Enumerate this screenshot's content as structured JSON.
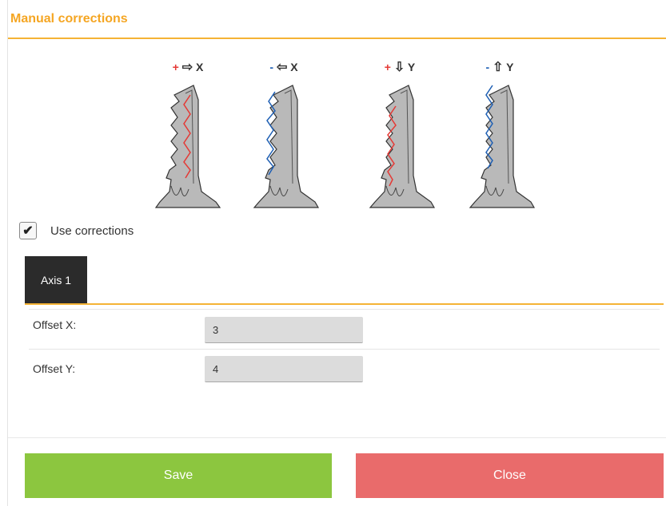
{
  "dialog": {
    "title": "Manual corrections"
  },
  "illustrations": [
    {
      "sign": "+",
      "arrow": "⇨",
      "axis": "X",
      "sign_color": "#e53935",
      "icon": "key-offset-plus-x-icon"
    },
    {
      "sign": "-",
      "arrow": "⇦",
      "axis": "X",
      "sign_color": "#1e5fb4",
      "icon": "key-offset-minus-x-icon"
    },
    {
      "sign": "+",
      "arrow": "⇩",
      "axis": "Y",
      "sign_color": "#e53935",
      "icon": "key-offset-plus-y-icon"
    },
    {
      "sign": "-",
      "arrow": "⇧",
      "axis": "Y",
      "sign_color": "#1e5fb4",
      "icon": "key-offset-minus-y-icon"
    }
  ],
  "use_corrections": {
    "label": "Use corrections",
    "checked": true
  },
  "tabs": [
    {
      "label": "Axis 1",
      "active": true
    }
  ],
  "fields": {
    "offset_x": {
      "label": "Offset X:",
      "value": "3"
    },
    "offset_y": {
      "label": "Offset Y:",
      "value": "4"
    }
  },
  "buttons": {
    "save": "Save",
    "close": "Close"
  },
  "colors": {
    "accent": "#f5a623",
    "save": "#8cc63f",
    "close": "#e96b6b",
    "tab_active": "#2b2b2b"
  }
}
